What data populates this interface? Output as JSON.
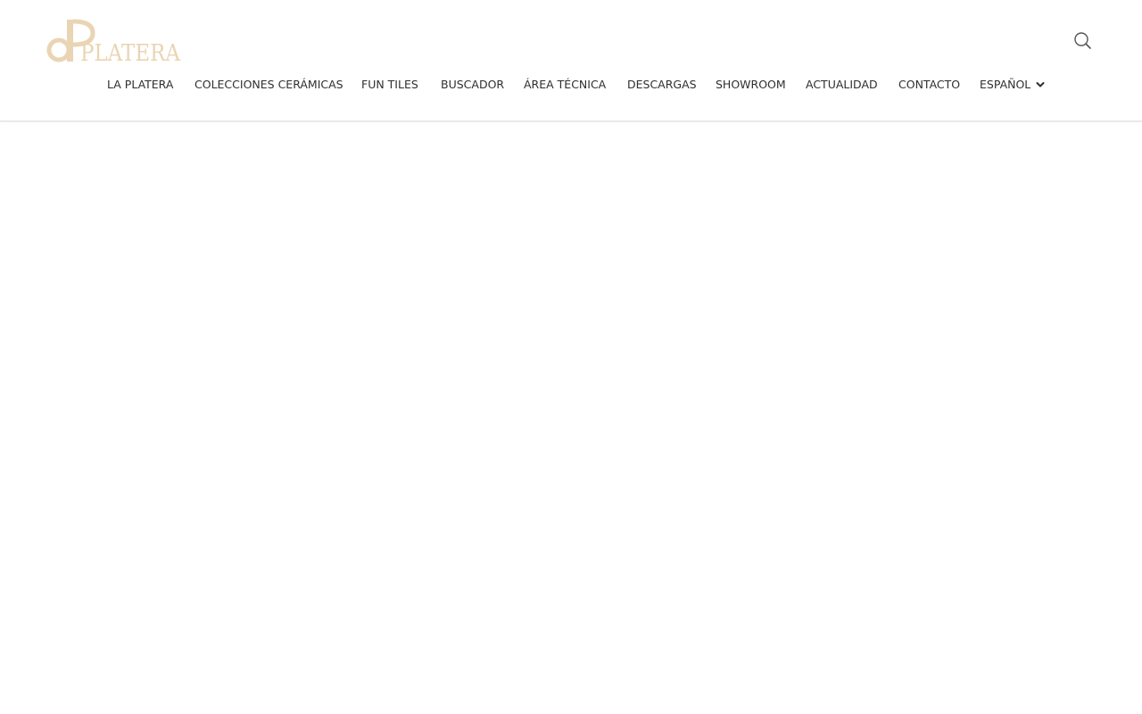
{
  "brand": {
    "logo_text": "PLATERA",
    "logo_color": "#e9d5b3"
  },
  "header": {
    "search_icon": "search-icon"
  },
  "nav": {
    "items": [
      {
        "label": "LA PLATERA"
      },
      {
        "label": "COLECCIONES CERÁMICAS"
      },
      {
        "label": "FUN TILES"
      },
      {
        "label": "BUSCADOR"
      },
      {
        "label": "ÁREA TÉCNICA"
      },
      {
        "label": "DESCARGAS"
      },
      {
        "label": "SHOWROOM"
      },
      {
        "label": "ACTUALIDAD"
      },
      {
        "label": "CONTACTO"
      }
    ],
    "language": {
      "label": "ESPAÑOL",
      "icon": "chevron-down-icon"
    }
  },
  "colors": {
    "nav_text": "#2f2f2f",
    "background": "#ffffff",
    "icon": "#555555"
  }
}
